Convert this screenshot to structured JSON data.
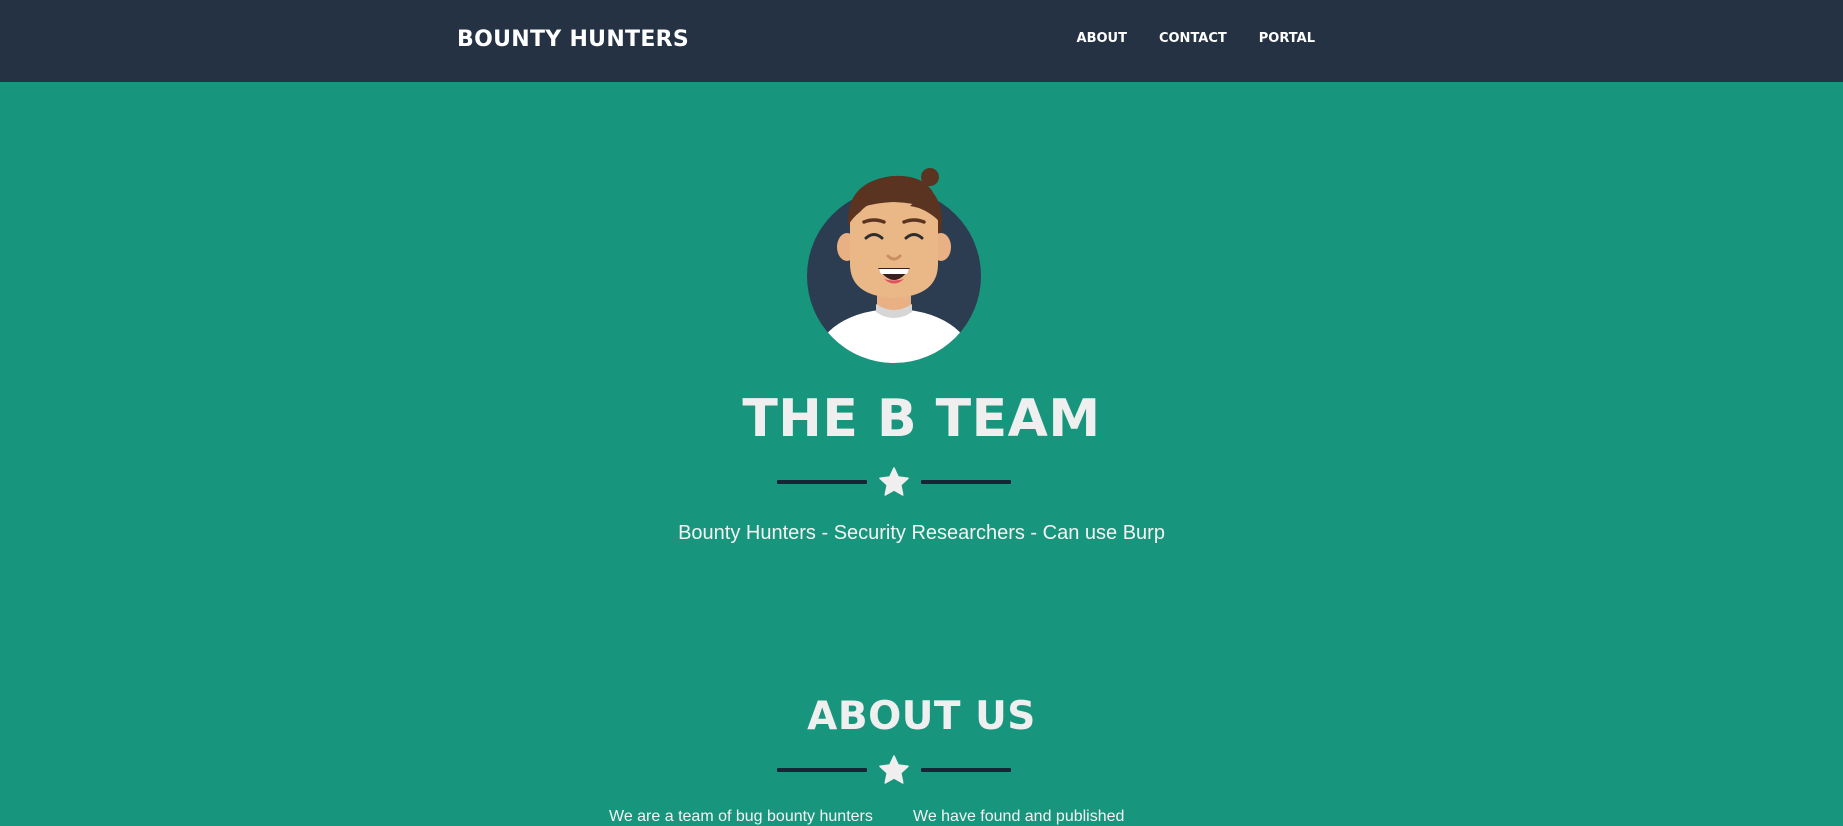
{
  "navbar": {
    "brand": "BOUNTY HUNTERS",
    "links": [
      "ABOUT",
      "CONTACT",
      "PORTAL"
    ]
  },
  "hero": {
    "title": "THE B TEAM",
    "subtitle": "Bounty Hunters - Security Researchers - Can use Burp"
  },
  "about": {
    "title": "ABOUT US",
    "left_text": "We are a team of bug bounty hunters",
    "right_text": "We have found and published"
  },
  "colors": {
    "navbar_bg": "#243244",
    "page_bg": "#18967d",
    "divider_line": "#172536",
    "text": "#efefef"
  }
}
